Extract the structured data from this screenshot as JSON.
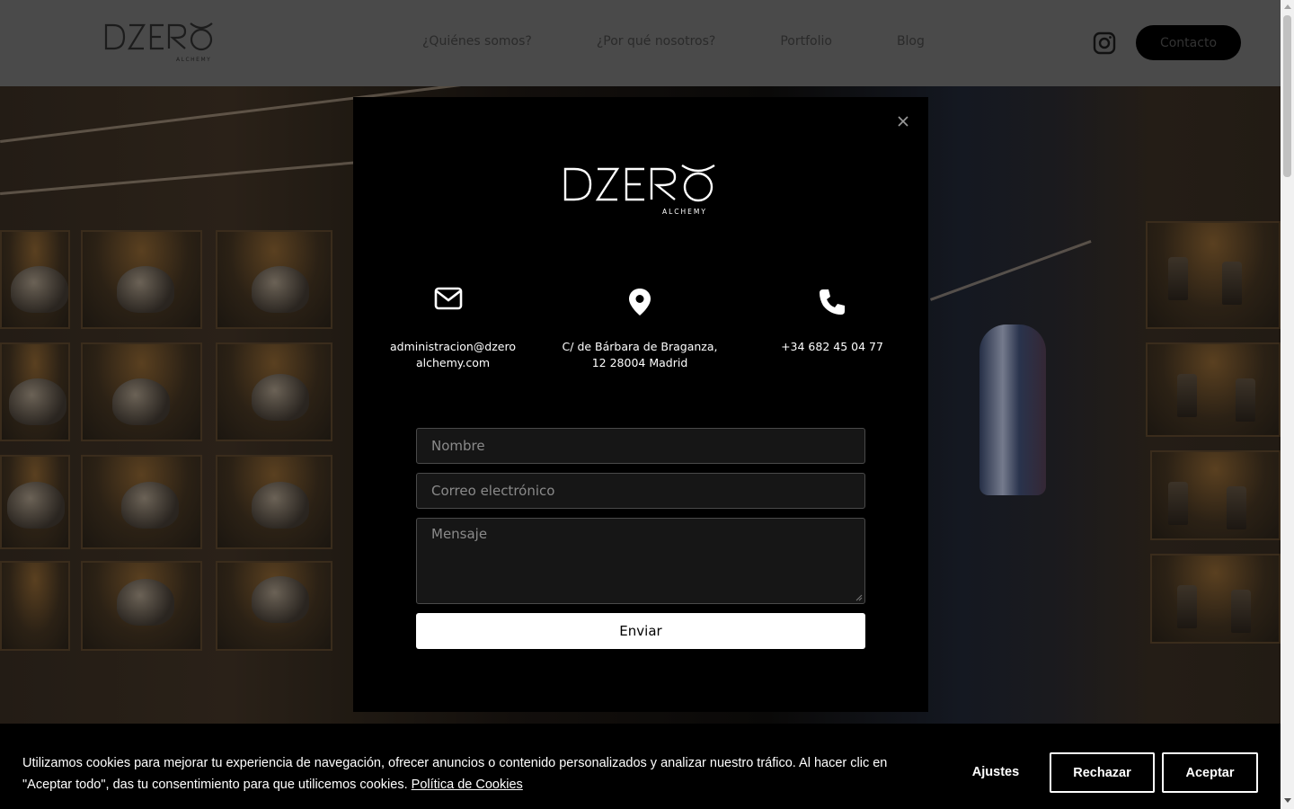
{
  "header": {
    "logo_icon": "dzero-alchemy-logo",
    "nav": [
      "¿Quiénes somos?",
      "¿Por qué nosotros?",
      "Portfolio",
      "Blog"
    ],
    "instagram_icon": "instagram-icon",
    "contact_label": "Contacto"
  },
  "modal": {
    "logo_icon": "dzero-alchemy-logo",
    "email_icon": "envelope-icon",
    "email": "administracion@dzero alchemy.com",
    "address_icon": "map-pin-icon",
    "address": "C/ de Bárbara de Braganza, 12 28004 Madrid",
    "phone_icon": "phone-icon",
    "phone": "+34 682 45 04 77",
    "form": {
      "name_placeholder": "Nombre",
      "email_placeholder": "Correo electrónico",
      "message_placeholder": "Mensaje",
      "submit_label": "Enviar"
    },
    "close_icon": "close-icon"
  },
  "cookie_banner": {
    "text": "Utilizamos cookies para mejorar tu experiencia de navegación, ofrecer anuncios o contenido personalizados y analizar nuestro tráfico. Al hacer clic en \"Aceptar todo\", das tu consentimiento para que utilicemos cookies.",
    "policy_link": "Política de Cookies",
    "settings_label": "Ajustes",
    "reject_label": "Rechazar",
    "accept_label": "Aceptar"
  },
  "colors": {
    "header_bg": "#4a4a4a",
    "modal_bg": "#000000",
    "button_bg": "#ffffff",
    "cookie_bg": "#000000"
  }
}
